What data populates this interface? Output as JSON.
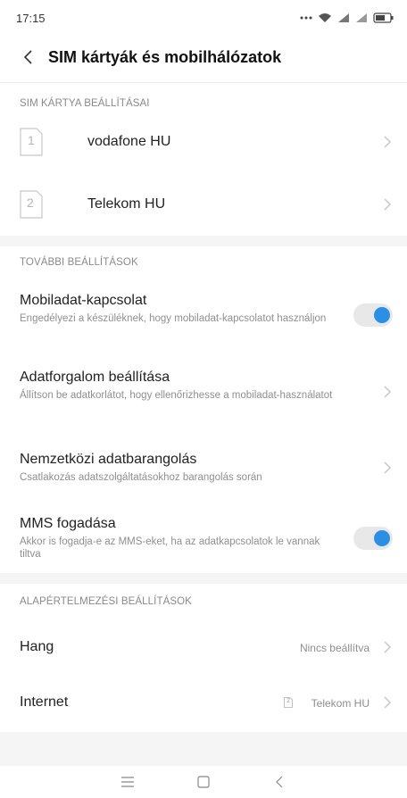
{
  "status": {
    "time": "17:15",
    "icons": [
      "more-dots-icon",
      "wifi-icon",
      "signal-icon",
      "signal-icon-2",
      "battery-icon"
    ]
  },
  "header": {
    "title": "SIM kártyák és mobilhálózatok",
    "back_icon": "back-arrow-icon"
  },
  "sim_section": {
    "header": "SIM KÁRTYA BEÁLLÍTÁSAI",
    "sims": [
      {
        "slot": "1",
        "name": "vodafone HU"
      },
      {
        "slot": "2",
        "name": "Telekom HU"
      }
    ]
  },
  "more_section": {
    "header": "TOVÁBBI BEÁLLÍTÁSOK",
    "items": [
      {
        "title": "Mobiladat-kapcsolat",
        "desc": "Engedélyezi a készüléknek, hogy mobiladat-kapcsolatot használjon",
        "control": "toggle",
        "on": true
      },
      {
        "title": "Adatforgalom beállítása",
        "desc": "Állítson be adatkorlátot, hogy ellenőrizhesse a mobiladat-használatot",
        "control": "chevron"
      },
      {
        "title": "Nemzetközi adatbarangolás",
        "desc": "Csatlakozás adatszolgáltatásokhoz barangolás során",
        "control": "chevron"
      },
      {
        "title": "MMS fogadása",
        "desc": "Akkor is fogadja-e az MMS-eket, ha az adatkapcsolatok le vannak tiltva",
        "control": "toggle",
        "on": true
      }
    ]
  },
  "default_section": {
    "header": "ALAPÉRTELMEZÉSI BEÁLLÍTÁSOK",
    "items": [
      {
        "title": "Hang",
        "value": "Nincs beállítva"
      },
      {
        "title": "Internet",
        "value": "Telekom HU",
        "sim_badge": "2"
      }
    ]
  },
  "nav": {
    "icons": [
      "menu-icon",
      "home-icon",
      "back-icon"
    ]
  },
  "colors": {
    "accent": "#2b8fe6",
    "gap": "#f5f5f5",
    "secondary_text": "#8f8f8f"
  }
}
